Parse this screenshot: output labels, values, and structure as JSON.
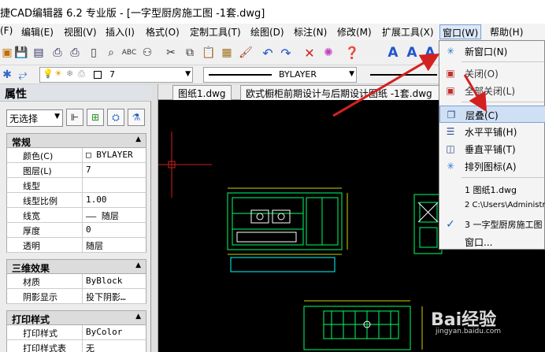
{
  "window": {
    "title": "捷CAD编辑器 6.2 专业版  - [一字型厨房施工图 -1套.dwg]"
  },
  "menu": [
    {
      "label": "(F)"
    },
    {
      "label": "编辑(E)"
    },
    {
      "label": "视图(V)"
    },
    {
      "label": "插入(I)"
    },
    {
      "label": "格式(O)"
    },
    {
      "label": "定制工具(T)"
    },
    {
      "label": "绘图(D)"
    },
    {
      "label": "标注(N)"
    },
    {
      "label": "修改(M)"
    },
    {
      "label": "扩展工具(X)"
    },
    {
      "label": "窗口(W)"
    },
    {
      "label": "帮助(H)"
    }
  ],
  "toolbar2": {
    "layer_value": "7",
    "linetype_value": "BYLAYER"
  },
  "properties": {
    "title": "属性",
    "selection": "无选择",
    "sections": [
      {
        "title": "常规",
        "rows": [
          {
            "key": "颜色(C)",
            "value": "□ BYLAYER"
          },
          {
            "key": "图层(L)",
            "value": "7"
          },
          {
            "key": "线型",
            "value": ""
          },
          {
            "key": "线型比例",
            "value": "1.00"
          },
          {
            "key": "线宽",
            "value": "—— 随层"
          },
          {
            "key": "厚度",
            "value": "0"
          },
          {
            "key": "透明",
            "value": "随层"
          }
        ]
      },
      {
        "title": "三维效果",
        "rows": [
          {
            "key": "材质",
            "value": "ByBlock"
          },
          {
            "key": "阴影显示",
            "value": "投下阴影…"
          }
        ]
      },
      {
        "title": "打印样式",
        "rows": [
          {
            "key": "打印样式",
            "value": "ByColor"
          },
          {
            "key": "打印样式表",
            "value": "无"
          }
        ]
      }
    ]
  },
  "tabs": [
    {
      "label": "图纸1.dwg"
    },
    {
      "label": "欧式橱柜前期设计与后期设计图纸 -1套.dwg"
    }
  ],
  "window_menu": {
    "items": [
      {
        "label": "新窗口(N)",
        "icon": "new-window-icon",
        "state": "normal"
      },
      {
        "label": "关闭(O)",
        "icon": "close-window-icon",
        "state": "normal"
      },
      {
        "label": "全部关闭(L)",
        "icon": "close-all-icon",
        "state": "normal"
      },
      {
        "label": "层叠(C)",
        "icon": "cascade-icon",
        "state": "highlighted"
      },
      {
        "label": "水平平铺(H)",
        "icon": "tile-horizontal-icon",
        "state": "normal"
      },
      {
        "label": "垂直平铺(T)",
        "icon": "tile-vertical-icon",
        "state": "normal"
      },
      {
        "label": "排列图标(A)",
        "icon": "arrange-icons-icon",
        "state": "normal"
      },
      {
        "label": "1 图纸1.dwg",
        "icon": "",
        "state": "normal"
      },
      {
        "label": "2 C:\\Users\\Administr",
        "icon": "",
        "state": "normal"
      },
      {
        "label": "3 一字型厨房施工图",
        "icon": "check-icon",
        "state": "checked"
      },
      {
        "label": "窗口...",
        "icon": "",
        "state": "normal"
      }
    ]
  },
  "watermark": {
    "text": "Bai经验",
    "sub": "jingyan.baidu.com"
  },
  "colors": {
    "accent_arrow": "#d42020",
    "canvas_bg": "#000000",
    "cad_lines": "#00ff66",
    "highlight": "#cfe0f5"
  }
}
